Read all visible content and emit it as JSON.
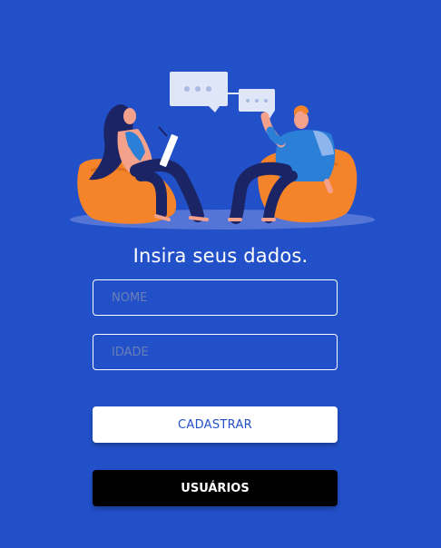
{
  "form": {
    "heading": "Insira seus dados.",
    "name_placeholder": "NOME",
    "age_placeholder": "IDADE",
    "name_value": "",
    "age_value": ""
  },
  "buttons": {
    "register_label": "CADASTRAR",
    "users_label": "USUÁRIOS"
  },
  "illustration": {
    "icon": "conversation-illustration"
  },
  "colors": {
    "background": "#2250c9",
    "register_text": "#2250c9",
    "users_bg": "#000000",
    "beanbag": "#f5832a",
    "bubble": "#dfe6f7"
  }
}
